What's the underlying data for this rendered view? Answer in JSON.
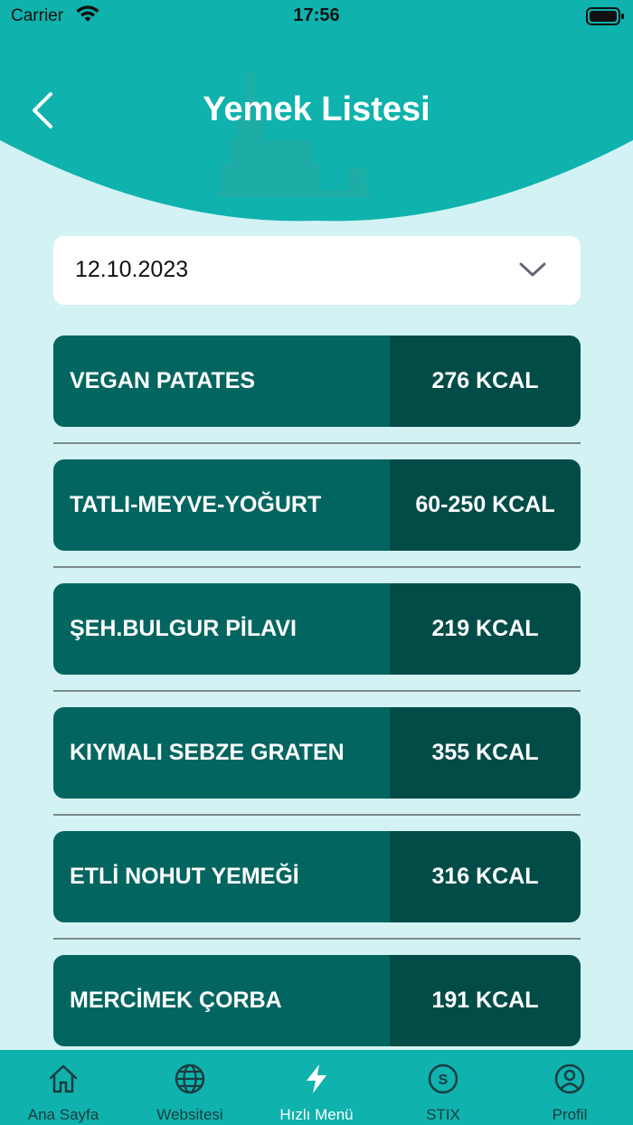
{
  "status_bar": {
    "carrier": "Carrier",
    "time": "17:56"
  },
  "header": {
    "title": "Yemek Listesi"
  },
  "date_select": {
    "value": "12.10.2023"
  },
  "meals": [
    {
      "name": "VEGAN PATATES",
      "kcal": "276 KCAL"
    },
    {
      "name": "TATLI-MEYVE-YOĞURT",
      "kcal": "60-250 KCAL"
    },
    {
      "name": "ŞEH.BULGUR PİLAVI",
      "kcal": "219 KCAL"
    },
    {
      "name": "KIYMALI SEBZE GRATEN",
      "kcal": "355 KCAL"
    },
    {
      "name": "ETLİ NOHUT YEMEĞİ",
      "kcal": "316 KCAL"
    },
    {
      "name": "MERCİMEK ÇORBA",
      "kcal": "191 KCAL"
    }
  ],
  "tab_bar": {
    "tabs": [
      {
        "label": "Ana Sayfa",
        "icon": "home-icon"
      },
      {
        "label": "Websitesi",
        "icon": "globe-icon"
      },
      {
        "label": "Hızlı Menü",
        "icon": "lightning-icon",
        "active": true
      },
      {
        "label": "STIX",
        "icon": "stix-coin-icon"
      },
      {
        "label": "Profil",
        "icon": "profile-icon"
      }
    ]
  },
  "colors": {
    "header_teal": "#0fb2ad",
    "background": "#d3f2f3",
    "meal_name_bg": "#036560",
    "meal_kcal_bg": "#024c48"
  }
}
